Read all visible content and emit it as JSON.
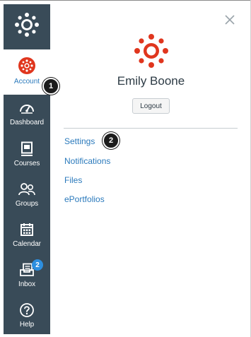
{
  "colors": {
    "nav_background": "#394b58",
    "link_blue": "#2b7abc",
    "brand_red": "#e0361e",
    "badge_blue": "#2d8fe0",
    "marker_black": "#1c1c1c"
  },
  "global_nav": {
    "logo_icon": "canvas-logo-icon",
    "account": {
      "label": "Account",
      "icon": "canvas-logo-icon",
      "active": true
    },
    "items": [
      {
        "label": "Dashboard",
        "icon": "dashboard-gauge-icon"
      },
      {
        "label": "Courses",
        "icon": "courses-book-icon"
      },
      {
        "label": "Groups",
        "icon": "groups-people-icon"
      },
      {
        "label": "Calendar",
        "icon": "calendar-icon"
      },
      {
        "label": "Inbox",
        "icon": "inbox-icon",
        "badge": "2"
      },
      {
        "label": "Help",
        "icon": "help-question-icon"
      }
    ]
  },
  "account_tray": {
    "close_icon": "close-icon",
    "user_name": "Emily Boone",
    "logout_label": "Logout",
    "links": [
      "Settings",
      "Notifications",
      "Files",
      "ePortfolios"
    ]
  },
  "callouts": [
    "1",
    "2"
  ]
}
